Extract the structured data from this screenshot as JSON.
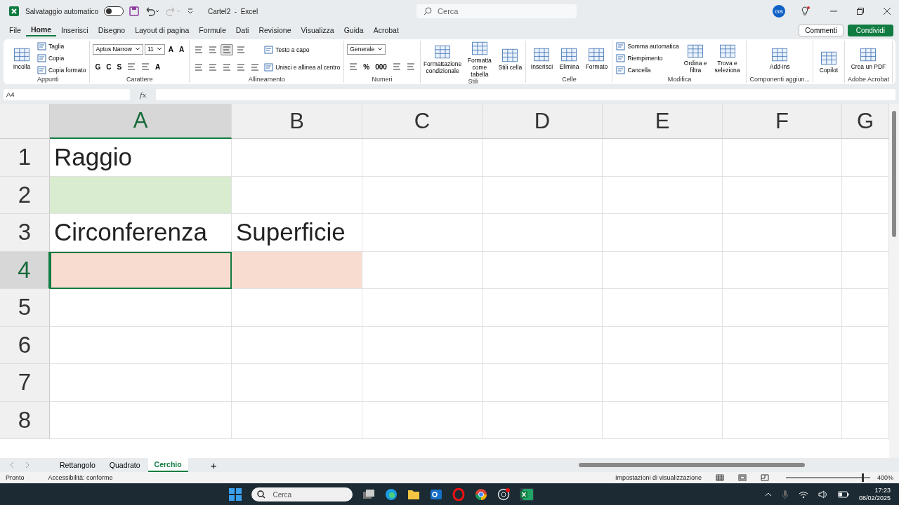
{
  "title_bar": {
    "autosave_label": "Salvataggio automatico",
    "autosave_on": false,
    "doc_title": "Cartel2  -  Excel",
    "search_placeholder": "Cerca",
    "avatar": "GB"
  },
  "menu_tabs": [
    {
      "label": "File",
      "selected": false
    },
    {
      "label": "Home",
      "selected": true
    },
    {
      "label": "Inserisci",
      "selected": false
    },
    {
      "label": "Disegno",
      "selected": false
    },
    {
      "label": "Layout di pagina",
      "selected": false
    },
    {
      "label": "Formule",
      "selected": false
    },
    {
      "label": "Dati",
      "selected": false
    },
    {
      "label": "Revisione",
      "selected": false
    },
    {
      "label": "Visualizza",
      "selected": false
    },
    {
      "label": "Guida",
      "selected": false
    },
    {
      "label": "Acrobat",
      "selected": false
    }
  ],
  "comments_label": "Commenti",
  "share_label": "Condividi",
  "ribbon": [
    {
      "name": "Appunti",
      "columns": [
        [
          [
            {
              "kind": "large",
              "label": "Incolla"
            }
          ]
        ],
        [
          [
            {
              "kind": "small",
              "label": "Taglia"
            }
          ],
          [
            {
              "kind": "small",
              "label": "Copia"
            }
          ],
          [
            {
              "kind": "small",
              "label": "Copia formato"
            }
          ]
        ]
      ]
    },
    {
      "name": "Carattere",
      "columns": [
        [
          [
            {
              "kind": "field",
              "label": "Aptos Narrow"
            },
            {
              "kind": "field",
              "label": "11"
            },
            {
              "kind": "glyph",
              "label": "A"
            },
            {
              "kind": "glyph",
              "label": "A"
            }
          ],
          [
            {
              "kind": "glyph",
              "label": "G"
            },
            {
              "kind": "glyph",
              "label": "C"
            },
            {
              "kind": "glyph",
              "label": "S"
            },
            {
              "kind": "icon",
              "selected": false
            },
            {
              "kind": "icon",
              "selected": false
            },
            {
              "kind": "glyph",
              "label": "A"
            }
          ]
        ]
      ]
    },
    {
      "name": "Allineamento",
      "columns": [
        [
          [
            {
              "kind": "icon",
              "selected": false
            },
            {
              "kind": "icon",
              "selected": false
            },
            {
              "kind": "icon",
              "selected": true
            },
            {
              "kind": "icon",
              "selected": false
            }
          ],
          [
            {
              "kind": "icon",
              "selected": false
            },
            {
              "kind": "icon",
              "selected": false
            },
            {
              "kind": "icon",
              "selected": false
            },
            {
              "kind": "icon",
              "selected": false
            },
            {
              "kind": "icon",
              "selected": false
            }
          ]
        ],
        [
          [
            {
              "kind": "small",
              "label": "Testo a capo"
            }
          ],
          [
            {
              "kind": "small",
              "label": "Unisci e allinea al centro"
            }
          ]
        ]
      ]
    },
    {
      "name": "Numeri",
      "columns": [
        [
          [
            {
              "kind": "field",
              "label": "Generale"
            }
          ],
          [
            {
              "kind": "icon",
              "selected": false
            },
            {
              "kind": "glyph",
              "label": "%"
            },
            {
              "kind": "glyph",
              "label": "000"
            },
            {
              "kind": "icon",
              "selected": false
            },
            {
              "kind": "icon",
              "selected": false
            }
          ]
        ]
      ]
    },
    {
      "name": "Stili",
      "columns": [
        [
          [
            {
              "kind": "large",
              "label": "Formattazione condizionale"
            }
          ]
        ],
        [
          [
            {
              "kind": "large",
              "label": "Formatta come tabella"
            }
          ]
        ],
        [
          [
            {
              "kind": "large",
              "label": "Stili cella"
            }
          ]
        ]
      ]
    },
    {
      "name": "Celle",
      "columns": [
        [
          [
            {
              "kind": "large",
              "label": "Inserisci"
            }
          ]
        ],
        [
          [
            {
              "kind": "large",
              "label": "Elimina"
            }
          ]
        ],
        [
          [
            {
              "kind": "large",
              "label": "Formato"
            }
          ]
        ]
      ]
    },
    {
      "name": "Modifica",
      "columns": [
        [
          [
            {
              "kind": "small",
              "label": "Somma automatica"
            }
          ],
          [
            {
              "kind": "small",
              "label": "Riempimento"
            }
          ],
          [
            {
              "kind": "small",
              "label": "Cancella"
            }
          ]
        ],
        [
          [
            {
              "kind": "large",
              "label": "Ordina e filtra"
            }
          ]
        ],
        [
          [
            {
              "kind": "large",
              "label": "Trova e seleziona"
            }
          ]
        ]
      ]
    },
    {
      "name": "Componenti aggiun...",
      "columns": [
        [
          [
            {
              "kind": "large",
              "label": "Add-ins"
            }
          ]
        ]
      ]
    },
    {
      "columns": [
        [
          [
            {
              "kind": "large",
              "label": "Copilot"
            }
          ]
        ]
      ]
    },
    {
      "name": "Adobe Acrobat",
      "columns": [
        [
          [
            {
              "kind": "large",
              "label": "Crea un PDF"
            }
          ]
        ]
      ]
    }
  ],
  "formula_bar": {
    "name_box": "A4",
    "fx": "fx"
  },
  "columns": [
    {
      "label": "A",
      "selected": true
    },
    {
      "label": "B",
      "selected": false
    },
    {
      "label": "C",
      "selected": false
    },
    {
      "label": "D",
      "selected": false
    },
    {
      "label": "E",
      "selected": false
    },
    {
      "label": "F",
      "selected": false
    },
    {
      "label": "G",
      "selected": false
    }
  ],
  "rows": [
    {
      "label": "1",
      "selected": false,
      "cells": [
        {
          "text": "Raggio",
          "selected": false
        },
        {
          "selected": false
        },
        {
          "selected": false
        },
        {
          "selected": false
        },
        {
          "selected": false
        },
        {
          "selected": false
        },
        {
          "selected": false
        }
      ]
    },
    {
      "label": "2",
      "selected": false,
      "cells": [
        {
          "color": "#d9ecd0",
          "selected": false
        },
        {
          "selected": false
        },
        {
          "selected": false
        },
        {
          "selected": false
        },
        {
          "selected": false
        },
        {
          "selected": false
        },
        {
          "selected": false
        }
      ]
    },
    {
      "label": "3",
      "selected": false,
      "cells": [
        {
          "text": "Circonferenza",
          "selected": false
        },
        {
          "text": "Superficie",
          "selected": false
        },
        {
          "selected": false
        },
        {
          "selected": false
        },
        {
          "selected": false
        },
        {
          "selected": false
        },
        {
          "selected": false
        }
      ]
    },
    {
      "label": "4",
      "selected": true,
      "cells": [
        {
          "color": "#f9dcd0",
          "selected": true
        },
        {
          "color": "#f9dcd0",
          "selected": false
        },
        {
          "selected": false
        },
        {
          "selected": false
        },
        {
          "selected": false
        },
        {
          "selected": false
        },
        {
          "selected": false
        }
      ]
    },
    {
      "label": "5",
      "selected": false,
      "cells": [
        {
          "selected": false
        },
        {
          "selected": false
        },
        {
          "selected": false
        },
        {
          "selected": false
        },
        {
          "selected": false
        },
        {
          "selected": false
        },
        {
          "selected": false
        }
      ]
    },
    {
      "label": "6",
      "selected": false,
      "cells": [
        {
          "selected": false
        },
        {
          "selected": false
        },
        {
          "selected": false
        },
        {
          "selected": false
        },
        {
          "selected": false
        },
        {
          "selected": false
        },
        {
          "selected": false
        }
      ]
    },
    {
      "label": "7",
      "selected": false,
      "cells": [
        {
          "selected": false
        },
        {
          "selected": false
        },
        {
          "selected": false
        },
        {
          "selected": false
        },
        {
          "selected": false
        },
        {
          "selected": false
        },
        {
          "selected": false
        }
      ]
    },
    {
      "label": "8",
      "selected": false,
      "cells": [
        {
          "selected": false
        },
        {
          "selected": false
        },
        {
          "selected": false
        },
        {
          "selected": false
        },
        {
          "selected": false
        },
        {
          "selected": false
        },
        {
          "selected": false
        }
      ]
    }
  ],
  "sheet_tabs": [
    {
      "label": "Rettangolo",
      "selected": false
    },
    {
      "label": "Quadrato",
      "selected": false
    },
    {
      "label": "Cerchio",
      "selected": true
    }
  ],
  "add_sheet": "+",
  "status_bar": {
    "ready": "Pronto",
    "accessibility": "Accessibilità: conforme",
    "display_settings": "Impostazioni di visualizzazione",
    "zoom": "400%",
    "level": 0.9
  },
  "taskbar": {
    "search_placeholder": "Cerca",
    "time": "17:23",
    "date": "08/02/2025"
  }
}
